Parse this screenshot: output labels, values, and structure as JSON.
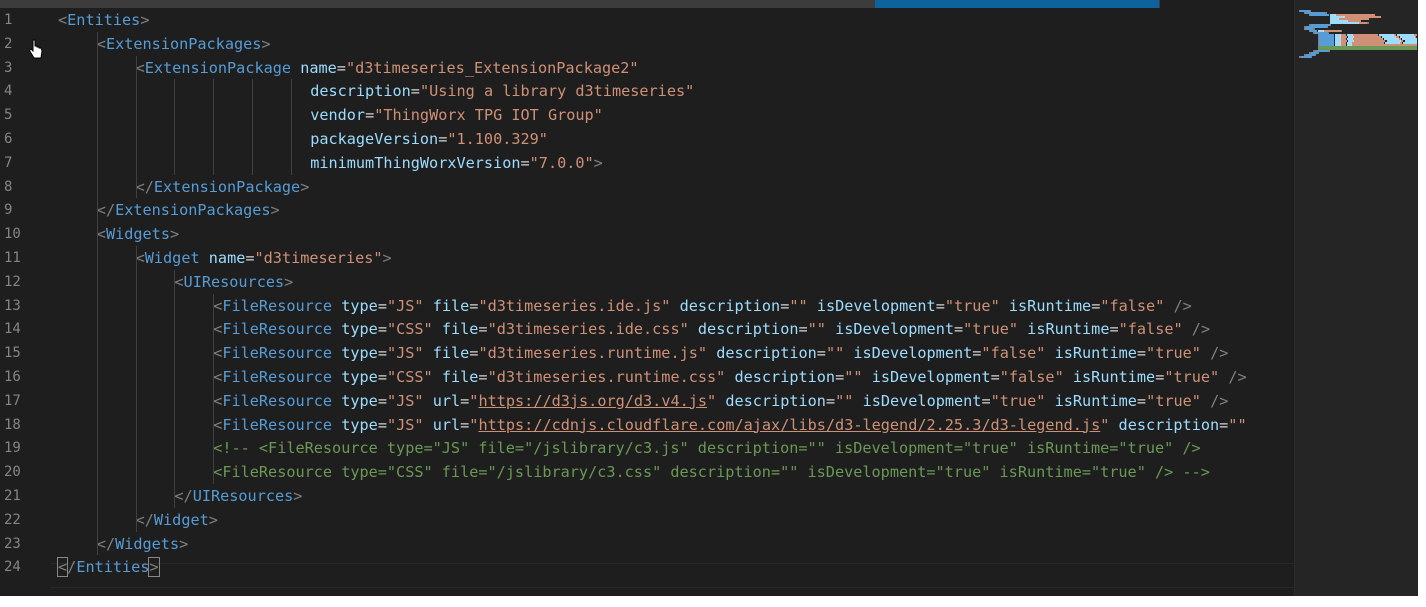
{
  "editor": {
    "line_numbers": [
      "1",
      "2",
      "3",
      "4",
      "5",
      "6",
      "7",
      "8",
      "9",
      "10",
      "11",
      "12",
      "13",
      "14",
      "15",
      "16",
      "17",
      "18",
      "19",
      "20",
      "21",
      "22",
      "23",
      "24"
    ],
    "lines": [
      [
        {
          "t": "br",
          "v": "<"
        },
        {
          "t": "tag",
          "v": "Entities"
        },
        {
          "t": "br",
          "v": ">"
        }
      ],
      [
        {
          "t": "br",
          "v": "<"
        },
        {
          "t": "tag",
          "v": "ExtensionPackages"
        },
        {
          "t": "br",
          "v": ">"
        }
      ],
      [
        {
          "t": "br",
          "v": "<"
        },
        {
          "t": "tag",
          "v": "ExtensionPackage"
        },
        {
          "t": "eq",
          "v": " "
        },
        {
          "t": "attr",
          "v": "name"
        },
        {
          "t": "eq",
          "v": "="
        },
        {
          "t": "str",
          "v": "\"d3timeseries_ExtensionPackage2\""
        }
      ],
      [
        {
          "t": "attr",
          "v": "description"
        },
        {
          "t": "eq",
          "v": "="
        },
        {
          "t": "str",
          "v": "\"Using a library d3timeseries\""
        }
      ],
      [
        {
          "t": "attr",
          "v": "vendor"
        },
        {
          "t": "eq",
          "v": "="
        },
        {
          "t": "str",
          "v": "\"ThingWorx TPG IOT Group\""
        }
      ],
      [
        {
          "t": "attr",
          "v": "packageVersion"
        },
        {
          "t": "eq",
          "v": "="
        },
        {
          "t": "str",
          "v": "\"1.100.329\""
        }
      ],
      [
        {
          "t": "attr",
          "v": "minimumThingWorxVersion"
        },
        {
          "t": "eq",
          "v": "="
        },
        {
          "t": "str",
          "v": "\"7.0.0\""
        },
        {
          "t": "br",
          "v": ">"
        }
      ],
      [
        {
          "t": "br",
          "v": "</"
        },
        {
          "t": "tag",
          "v": "ExtensionPackage"
        },
        {
          "t": "br",
          "v": ">"
        }
      ],
      [
        {
          "t": "br",
          "v": "</"
        },
        {
          "t": "tag",
          "v": "ExtensionPackages"
        },
        {
          "t": "br",
          "v": ">"
        }
      ],
      [
        {
          "t": "br",
          "v": "<"
        },
        {
          "t": "tag",
          "v": "Widgets"
        },
        {
          "t": "br",
          "v": ">"
        }
      ],
      [
        {
          "t": "br",
          "v": "<"
        },
        {
          "t": "tag",
          "v": "Widget"
        },
        {
          "t": "eq",
          "v": " "
        },
        {
          "t": "attr",
          "v": "name"
        },
        {
          "t": "eq",
          "v": "="
        },
        {
          "t": "str",
          "v": "\"d3timeseries\""
        },
        {
          "t": "br",
          "v": ">"
        }
      ],
      [
        {
          "t": "br",
          "v": "<"
        },
        {
          "t": "tag",
          "v": "UIResources"
        },
        {
          "t": "br",
          "v": ">"
        }
      ],
      [
        {
          "t": "br",
          "v": "<"
        },
        {
          "t": "tag",
          "v": "FileResource"
        },
        {
          "t": "eq",
          "v": " "
        },
        {
          "t": "attr",
          "v": "type"
        },
        {
          "t": "eq",
          "v": "="
        },
        {
          "t": "str",
          "v": "\"JS\""
        },
        {
          "t": "eq",
          "v": " "
        },
        {
          "t": "attr",
          "v": "file"
        },
        {
          "t": "eq",
          "v": "="
        },
        {
          "t": "str",
          "v": "\"d3timeseries.ide.js\""
        },
        {
          "t": "eq",
          "v": " "
        },
        {
          "t": "attr",
          "v": "description"
        },
        {
          "t": "eq",
          "v": "="
        },
        {
          "t": "str",
          "v": "\"\""
        },
        {
          "t": "eq",
          "v": " "
        },
        {
          "t": "attr",
          "v": "isDevelopment"
        },
        {
          "t": "eq",
          "v": "="
        },
        {
          "t": "str",
          "v": "\"true\""
        },
        {
          "t": "eq",
          "v": " "
        },
        {
          "t": "attr",
          "v": "isRuntime"
        },
        {
          "t": "eq",
          "v": "="
        },
        {
          "t": "str",
          "v": "\"false\""
        },
        {
          "t": "eq",
          "v": " "
        },
        {
          "t": "br",
          "v": "/>"
        }
      ],
      [
        {
          "t": "br",
          "v": "<"
        },
        {
          "t": "tag",
          "v": "FileResource"
        },
        {
          "t": "eq",
          "v": " "
        },
        {
          "t": "attr",
          "v": "type"
        },
        {
          "t": "eq",
          "v": "="
        },
        {
          "t": "str",
          "v": "\"CSS\""
        },
        {
          "t": "eq",
          "v": " "
        },
        {
          "t": "attr",
          "v": "file"
        },
        {
          "t": "eq",
          "v": "="
        },
        {
          "t": "str",
          "v": "\"d3timeseries.ide.css\""
        },
        {
          "t": "eq",
          "v": " "
        },
        {
          "t": "attr",
          "v": "description"
        },
        {
          "t": "eq",
          "v": "="
        },
        {
          "t": "str",
          "v": "\"\""
        },
        {
          "t": "eq",
          "v": " "
        },
        {
          "t": "attr",
          "v": "isDevelopment"
        },
        {
          "t": "eq",
          "v": "="
        },
        {
          "t": "str",
          "v": "\"true\""
        },
        {
          "t": "eq",
          "v": " "
        },
        {
          "t": "attr",
          "v": "isRuntime"
        },
        {
          "t": "eq",
          "v": "="
        },
        {
          "t": "str",
          "v": "\"false\""
        },
        {
          "t": "eq",
          "v": " "
        },
        {
          "t": "br",
          "v": "/>"
        }
      ],
      [
        {
          "t": "br",
          "v": "<"
        },
        {
          "t": "tag",
          "v": "FileResource"
        },
        {
          "t": "eq",
          "v": " "
        },
        {
          "t": "attr",
          "v": "type"
        },
        {
          "t": "eq",
          "v": "="
        },
        {
          "t": "str",
          "v": "\"JS\""
        },
        {
          "t": "eq",
          "v": " "
        },
        {
          "t": "attr",
          "v": "file"
        },
        {
          "t": "eq",
          "v": "="
        },
        {
          "t": "str",
          "v": "\"d3timeseries.runtime.js\""
        },
        {
          "t": "eq",
          "v": " "
        },
        {
          "t": "attr",
          "v": "description"
        },
        {
          "t": "eq",
          "v": "="
        },
        {
          "t": "str",
          "v": "\"\""
        },
        {
          "t": "eq",
          "v": " "
        },
        {
          "t": "attr",
          "v": "isDevelopment"
        },
        {
          "t": "eq",
          "v": "="
        },
        {
          "t": "str",
          "v": "\"false\""
        },
        {
          "t": "eq",
          "v": " "
        },
        {
          "t": "attr",
          "v": "isRuntime"
        },
        {
          "t": "eq",
          "v": "="
        },
        {
          "t": "str",
          "v": "\"true\""
        },
        {
          "t": "eq",
          "v": " "
        },
        {
          "t": "br",
          "v": "/>"
        }
      ],
      [
        {
          "t": "br",
          "v": "<"
        },
        {
          "t": "tag",
          "v": "FileResource"
        },
        {
          "t": "eq",
          "v": " "
        },
        {
          "t": "attr",
          "v": "type"
        },
        {
          "t": "eq",
          "v": "="
        },
        {
          "t": "str",
          "v": "\"CSS\""
        },
        {
          "t": "eq",
          "v": " "
        },
        {
          "t": "attr",
          "v": "file"
        },
        {
          "t": "eq",
          "v": "="
        },
        {
          "t": "str",
          "v": "\"d3timeseries.runtime.css\""
        },
        {
          "t": "eq",
          "v": " "
        },
        {
          "t": "attr",
          "v": "description"
        },
        {
          "t": "eq",
          "v": "="
        },
        {
          "t": "str",
          "v": "\"\""
        },
        {
          "t": "eq",
          "v": " "
        },
        {
          "t": "attr",
          "v": "isDevelopment"
        },
        {
          "t": "eq",
          "v": "="
        },
        {
          "t": "str",
          "v": "\"false\""
        },
        {
          "t": "eq",
          "v": " "
        },
        {
          "t": "attr",
          "v": "isRuntime"
        },
        {
          "t": "eq",
          "v": "="
        },
        {
          "t": "str",
          "v": "\"true\""
        },
        {
          "t": "eq",
          "v": " "
        },
        {
          "t": "br",
          "v": "/>"
        }
      ],
      [
        {
          "t": "br",
          "v": "<"
        },
        {
          "t": "tag",
          "v": "FileResource"
        },
        {
          "t": "eq",
          "v": " "
        },
        {
          "t": "attr",
          "v": "type"
        },
        {
          "t": "eq",
          "v": "="
        },
        {
          "t": "str",
          "v": "\"JS\""
        },
        {
          "t": "eq",
          "v": " "
        },
        {
          "t": "attr",
          "v": "url"
        },
        {
          "t": "eq",
          "v": "="
        },
        {
          "t": "str",
          "v": "\""
        },
        {
          "t": "url",
          "v": "https://d3js.org/d3.v4.js"
        },
        {
          "t": "str",
          "v": "\""
        },
        {
          "t": "eq",
          "v": " "
        },
        {
          "t": "attr",
          "v": "description"
        },
        {
          "t": "eq",
          "v": "="
        },
        {
          "t": "str",
          "v": "\"\""
        },
        {
          "t": "eq",
          "v": " "
        },
        {
          "t": "attr",
          "v": "isDevelopment"
        },
        {
          "t": "eq",
          "v": "="
        },
        {
          "t": "str",
          "v": "\"true\""
        },
        {
          "t": "eq",
          "v": " "
        },
        {
          "t": "attr",
          "v": "isRuntime"
        },
        {
          "t": "eq",
          "v": "="
        },
        {
          "t": "str",
          "v": "\"true\""
        },
        {
          "t": "eq",
          "v": " "
        },
        {
          "t": "br",
          "v": "/>"
        }
      ],
      [
        {
          "t": "br",
          "v": "<"
        },
        {
          "t": "tag",
          "v": "FileResource"
        },
        {
          "t": "eq",
          "v": " "
        },
        {
          "t": "attr",
          "v": "type"
        },
        {
          "t": "eq",
          "v": "="
        },
        {
          "t": "str",
          "v": "\"JS\""
        },
        {
          "t": "eq",
          "v": " "
        },
        {
          "t": "attr",
          "v": "url"
        },
        {
          "t": "eq",
          "v": "="
        },
        {
          "t": "str",
          "v": "\""
        },
        {
          "t": "url",
          "v": "https://cdnjs.cloudflare.com/ajax/libs/d3-legend/2.25.3/d3-legend.js"
        },
        {
          "t": "str",
          "v": "\""
        },
        {
          "t": "eq",
          "v": " "
        },
        {
          "t": "attr",
          "v": "description"
        },
        {
          "t": "eq",
          "v": "="
        },
        {
          "t": "str",
          "v": "\"\""
        }
      ],
      [
        {
          "t": "com",
          "v": "<!-- <FileResource type=\"JS\" file=\"/jslibrary/c3.js\" description=\"\" isDevelopment=\"true\" isRuntime=\"true\" />"
        }
      ],
      [
        {
          "t": "com",
          "v": "<FileResource type=\"CSS\" file=\"/jslibrary/c3.css\" description=\"\" isDevelopment=\"true\" isRuntime=\"true\" /> -->"
        }
      ],
      [
        {
          "t": "br",
          "v": "</"
        },
        {
          "t": "tag",
          "v": "UIResources"
        },
        {
          "t": "br",
          "v": ">"
        }
      ],
      [
        {
          "t": "br",
          "v": "</"
        },
        {
          "t": "tag",
          "v": "Widget"
        },
        {
          "t": "br",
          "v": ">"
        }
      ],
      [
        {
          "t": "br",
          "v": "</"
        },
        {
          "t": "tag",
          "v": "Widgets"
        },
        {
          "t": "br",
          "v": ">"
        }
      ],
      [
        {
          "t": "br",
          "v": "<",
          "box": true
        },
        {
          "t": "br",
          "v": "/"
        },
        {
          "t": "tag",
          "v": "Entities"
        },
        {
          "t": "br",
          "v": ">",
          "box": true
        }
      ]
    ],
    "colors": {
      "background": "#1e1e1e",
      "tag": "#569cd6",
      "bracket": "#808080",
      "attribute": "#9cdcfe",
      "string": "#ce9178",
      "comment": "#6a9955",
      "line_number": "#858585"
    },
    "cursor_icon": "hand-pointer-icon"
  }
}
